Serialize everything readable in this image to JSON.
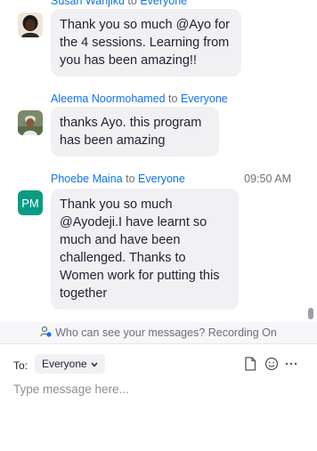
{
  "messages": [
    {
      "sender": "Susan Wanjiku",
      "to_word": "to",
      "recipient": "Everyone",
      "time": "",
      "avatar_initials": "",
      "lines": [
        "Thank you so much @Ayo for",
        "the 4 sessions. Learning from",
        "you has been amazing!!"
      ]
    },
    {
      "sender": "Aleema Noormohamed",
      "to_word": "to",
      "recipient": "Everyone",
      "time": "",
      "avatar_initials": "",
      "lines": [
        "thanks Ayo.  this program",
        "has been amazing"
      ]
    },
    {
      "sender": "Phoebe Maina",
      "to_word": "to",
      "recipient": "Everyone",
      "time": "09:50 AM",
      "avatar_initials": "PM",
      "lines": [
        "Thank you so much",
        "@Ayodeji.I have learnt so",
        "much and have been",
        "challenged. Thanks to",
        "Women work for putting this",
        "together"
      ]
    }
  ],
  "privacy_notice": "Who can see your messages? Recording On",
  "composer": {
    "to_label": "To:",
    "recipient": "Everyone",
    "placeholder": "Type message here..."
  },
  "icons": {
    "privacy": "person-lock-icon",
    "dropdown": "chevron-down-icon",
    "file": "file-icon",
    "emoji": "emoji-icon",
    "more": "more-icon"
  },
  "colors": {
    "accent": "#0e72ed",
    "bubble": "#f1f1f3",
    "avatar_pm": "#0a9b84"
  }
}
